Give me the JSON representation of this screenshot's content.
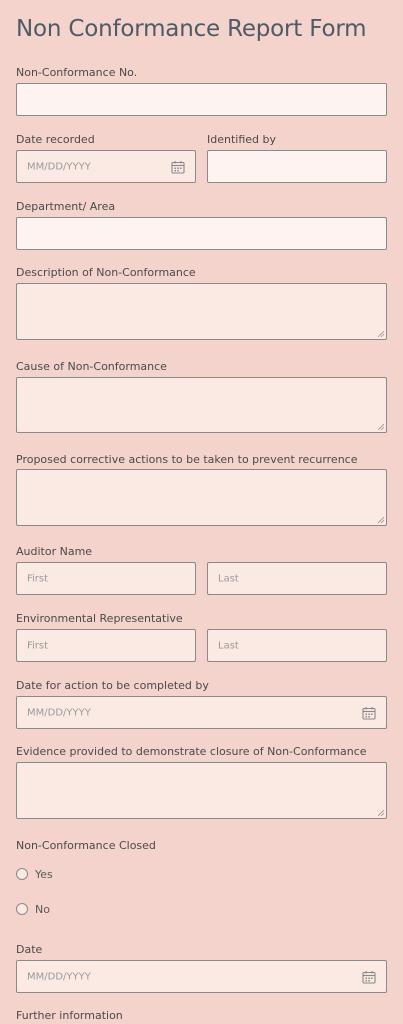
{
  "form": {
    "title": "Non Conformance Report Form"
  },
  "fields": {
    "nc_number": {
      "label": "Non-Conformance No."
    },
    "date_recorded": {
      "label": "Date recorded",
      "placeholder": "MM/DD/YYYY"
    },
    "identified_by": {
      "label": "Identified by"
    },
    "department": {
      "label": "Department/ Area"
    },
    "description": {
      "label": "Description of Non-Conformance"
    },
    "cause": {
      "label": "Cause of Non-Conformance"
    },
    "corrective_actions": {
      "label": "Proposed corrective actions to be taken to prevent recurrence"
    },
    "auditor_name": {
      "label": "Auditor Name",
      "first_placeholder": "First",
      "last_placeholder": "Last"
    },
    "env_rep": {
      "label": "Environmental Representative",
      "first_placeholder": "First",
      "last_placeholder": "Last"
    },
    "action_date": {
      "label": "Date for action to be completed by",
      "placeholder": "MM/DD/YYYY"
    },
    "evidence": {
      "label": "Evidence provided to demonstrate closure of Non-Conformance"
    },
    "closed": {
      "label": "Non-Conformance Closed",
      "options": [
        "Yes",
        "No"
      ]
    },
    "date": {
      "label": "Date",
      "placeholder": "MM/DD/YYYY"
    },
    "further_info": {
      "label": "Further information"
    }
  },
  "icons": {
    "calendar": "calendar-icon",
    "resize": "resize-handle-icon"
  },
  "colors": {
    "background": "#f3d3cb",
    "field": "#fbe9e4",
    "title": "#4e5b66"
  }
}
